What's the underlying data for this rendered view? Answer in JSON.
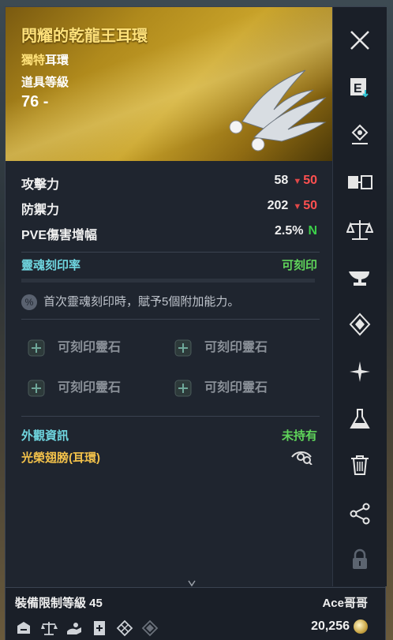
{
  "item": {
    "name": "閃耀的乾龍王耳環",
    "rarity": "獨特",
    "kind": "耳環",
    "item_level_label": "道具等級",
    "item_level": "76 -"
  },
  "stats": [
    {
      "label": "攻擊力",
      "value": "58",
      "diff": "50"
    },
    {
      "label": "防禦力",
      "value": "202",
      "diff": "50"
    },
    {
      "label": "PVE傷害增幅",
      "value": "2.5%",
      "badge": "N"
    }
  ],
  "soul": {
    "label": "靈魂刻印率",
    "status": "可刻印",
    "note_icon": "%",
    "note": "首次靈魂刻印時，賦予5個附加能力。",
    "slots": [
      "可刻印靈石",
      "可刻印靈石",
      "可刻印靈石",
      "可刻印靈石"
    ]
  },
  "appearance": {
    "label": "外觀資訊",
    "status": "未持有",
    "name": "光榮翅膀(耳環)"
  },
  "footer": {
    "equip_limit": "裝備限制等級 45",
    "seller": "Ace哥哥",
    "price": "20,256"
  },
  "rail_icons": [
    "close-icon",
    "extract-icon",
    "pin-icon",
    "compare-icon",
    "scale-icon",
    "anvil-icon",
    "enchant-icon",
    "sparkle-icon",
    "flask-icon",
    "trash-icon",
    "share-icon",
    "lock-icon"
  ],
  "colors": {
    "gold_title": "#ffe27a",
    "teal": "#6fd6e0",
    "green": "#5fd45a",
    "red": "#ff5050",
    "panel_bg": "#1f252f"
  }
}
